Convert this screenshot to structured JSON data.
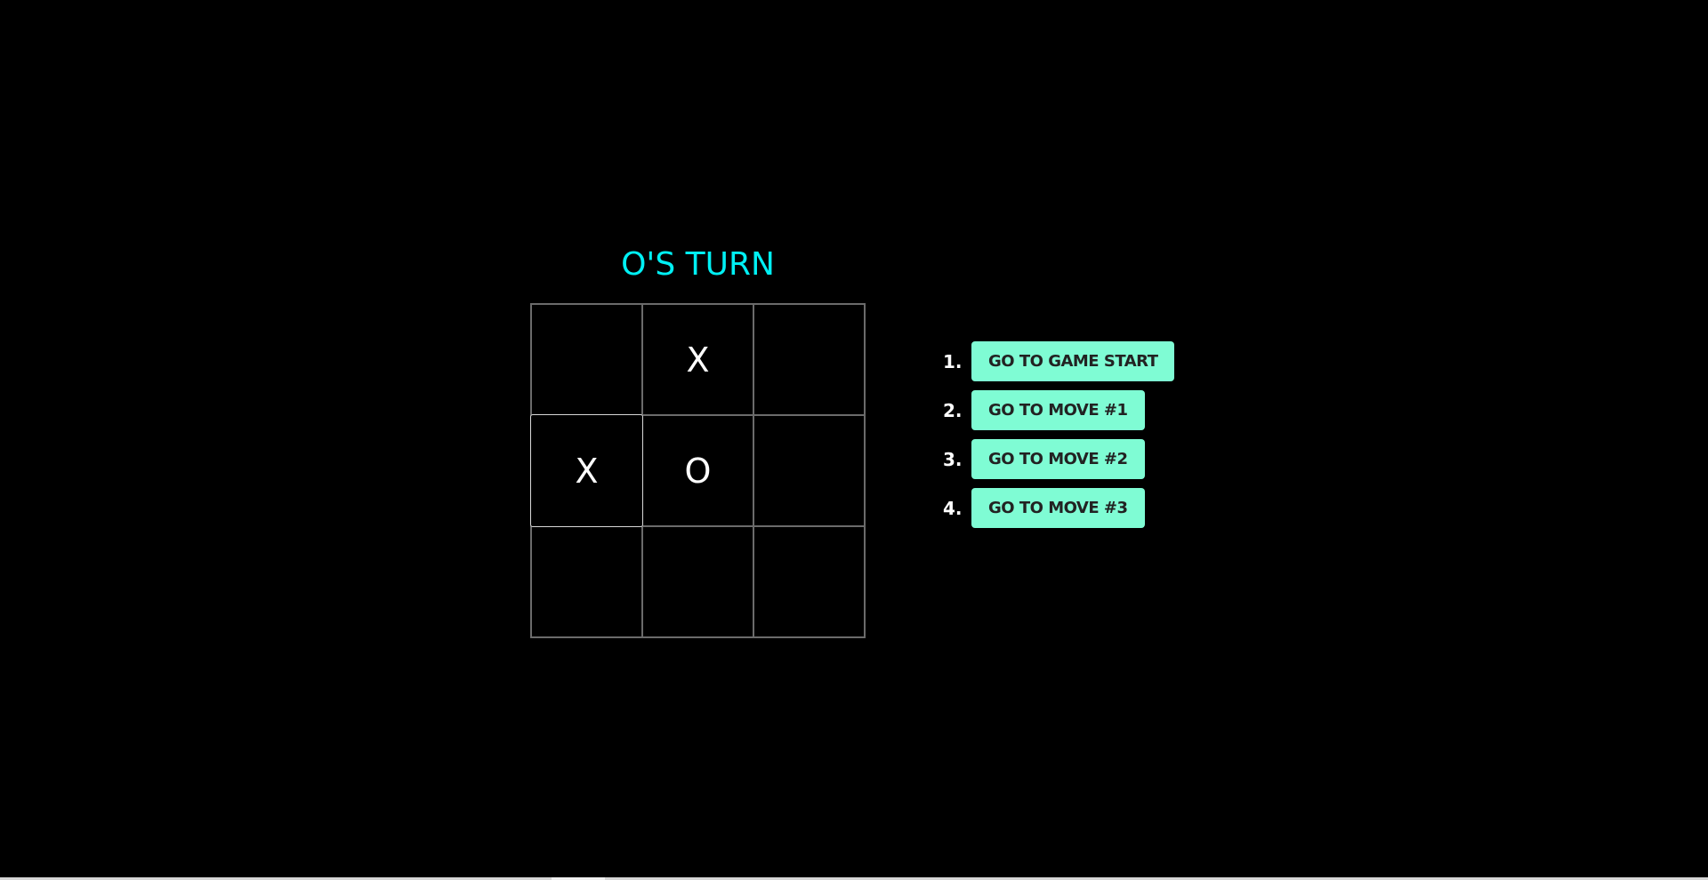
{
  "game": {
    "status": "O'S TURN",
    "board": [
      "",
      "X",
      "",
      "X",
      "O",
      "",
      "",
      "",
      ""
    ],
    "focused_square": 3
  },
  "history": {
    "moves": [
      {
        "number": "1.",
        "label": "GO TO GAME START"
      },
      {
        "number": "2.",
        "label": "GO TO MOVE #1"
      },
      {
        "number": "3.",
        "label": "GO TO MOVE #2"
      },
      {
        "number": "4.",
        "label": "GO TO MOVE #3"
      }
    ]
  },
  "colors": {
    "background": "#000000",
    "status_text": "#00f0f4",
    "button_bg": "#7ffcd4",
    "button_text": "#222222",
    "grid_line": "#6b6b6b",
    "mark": "#ffffff"
  }
}
